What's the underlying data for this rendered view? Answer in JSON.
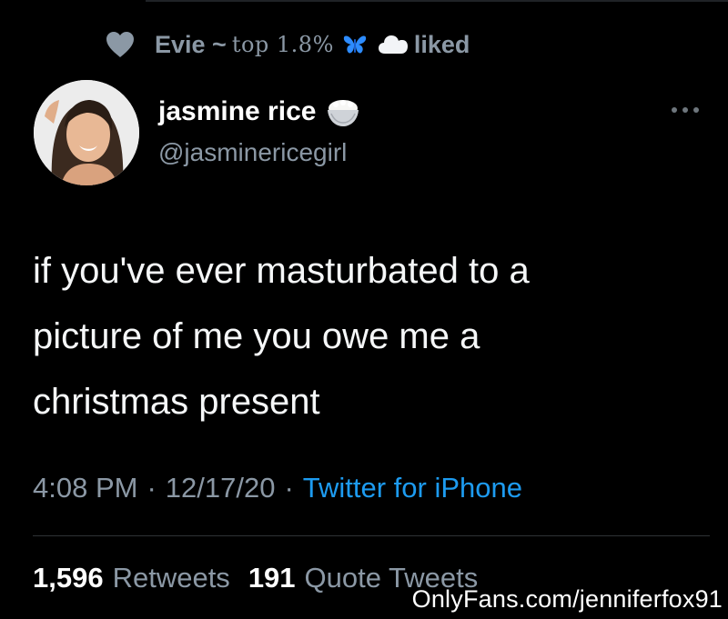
{
  "social_context": {
    "name_prefix": "Evie ~",
    "name_mono": "top 1.8%",
    "action": "liked",
    "icons": [
      "heart-icon",
      "butterfly-icon",
      "cloud-icon"
    ]
  },
  "author": {
    "display_name": "jasmine rice",
    "handle": "@jasminericegirl",
    "name_emoji": "rice-bowl-icon"
  },
  "tweet": {
    "text_lines": [
      "if you've ever masturbated to a",
      "picture of me you owe me a",
      "christmas present"
    ]
  },
  "meta": {
    "time": "4:08 PM",
    "separator": "·",
    "date": "12/17/20",
    "source": "Twitter for iPhone"
  },
  "stats": {
    "retweets_count": "1,596",
    "retweets_label": "Retweets",
    "quotes_count": "191",
    "quotes_label": "Quote Tweets"
  },
  "watermark": "OnlyFans.com/jenniferfox91",
  "colors": {
    "background": "#000000",
    "secondary_text": "#8b98a5",
    "link": "#1d9bf0",
    "primary_text": "#ffffff"
  }
}
